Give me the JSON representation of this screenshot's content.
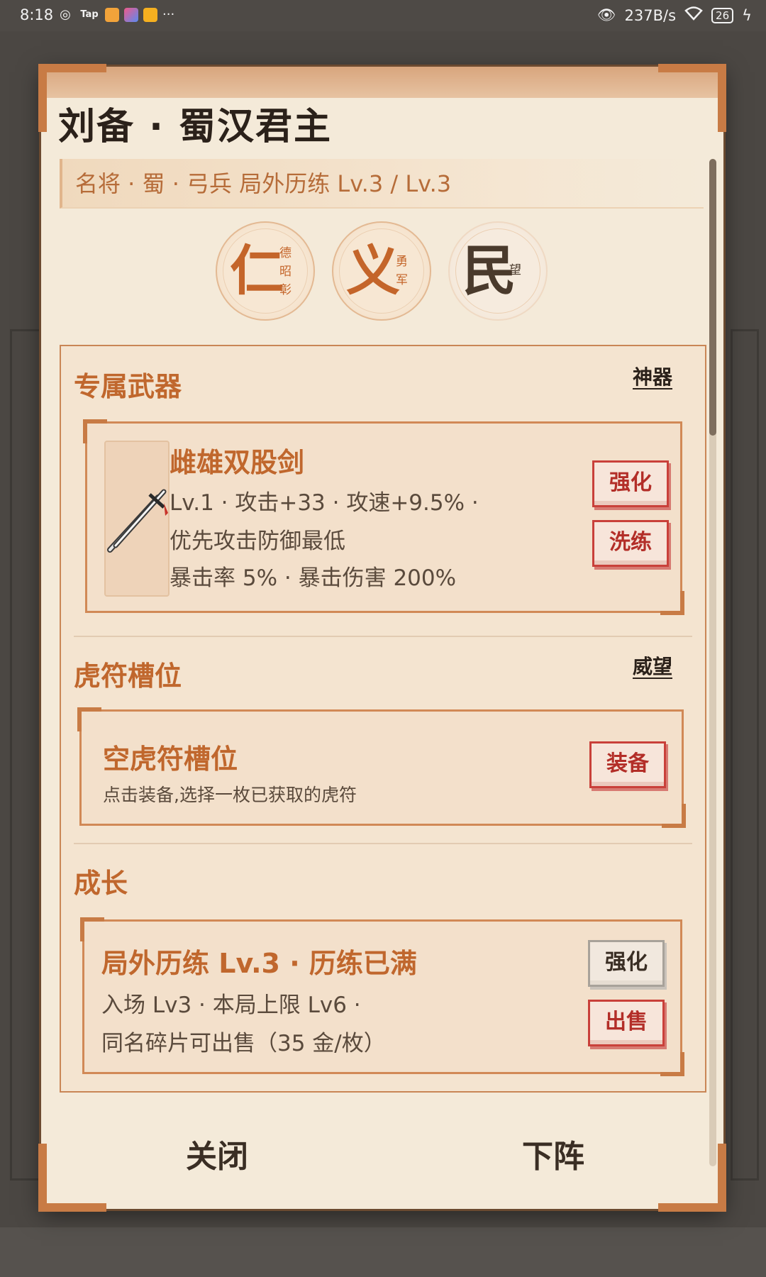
{
  "status_bar": {
    "time": "8:18",
    "net_speed": "237B/s",
    "battery": "26"
  },
  "dialog": {
    "title": "刘备 · 蜀汉君主",
    "subtitle": "名将 · 蜀 · 弓兵  局外历练 Lv.3 / Lv.3",
    "traits": [
      {
        "char": "仁",
        "desc_lines": [
          "德",
          "昭",
          "彰"
        ]
      },
      {
        "char": "义",
        "desc_lines": [
          "勇",
          "军"
        ]
      },
      {
        "char": "民",
        "desc_lines": [
          "望"
        ]
      }
    ],
    "weapon_section": {
      "title": "专属武器",
      "tag": "神器",
      "weapon": {
        "name": "雌雄双股剑",
        "line1": "Lv.1 · 攻击+33 · 攻速+9.5% ·",
        "line2": "优先攻击防御最低",
        "line3": "暴击率 5% · 暴击伤害 200%",
        "btn_upgrade": "强化",
        "btn_refine": "洗练"
      }
    },
    "tiger_section": {
      "title": "虎符槽位",
      "tag": "威望",
      "slot_name": "空虎符槽位",
      "slot_hint": "点击装备,选择一枚已获取的虎符",
      "btn_equip": "装备"
    },
    "growth_section": {
      "title": "成长",
      "name": "局外历练 Lv.3 · 历练已满",
      "line1": "入场 Lv3 · 本局上限 Lv6 ·",
      "line2": "同名碎片可出售（35 金/枚）",
      "btn_upgrade": "强化",
      "btn_sell": "出售"
    },
    "footer": {
      "close": "关闭",
      "unassign": "下阵"
    }
  },
  "colors": {
    "accent": "#c0672d",
    "button_red": "#c9403a",
    "panel_bg": "#f4e4d0"
  }
}
